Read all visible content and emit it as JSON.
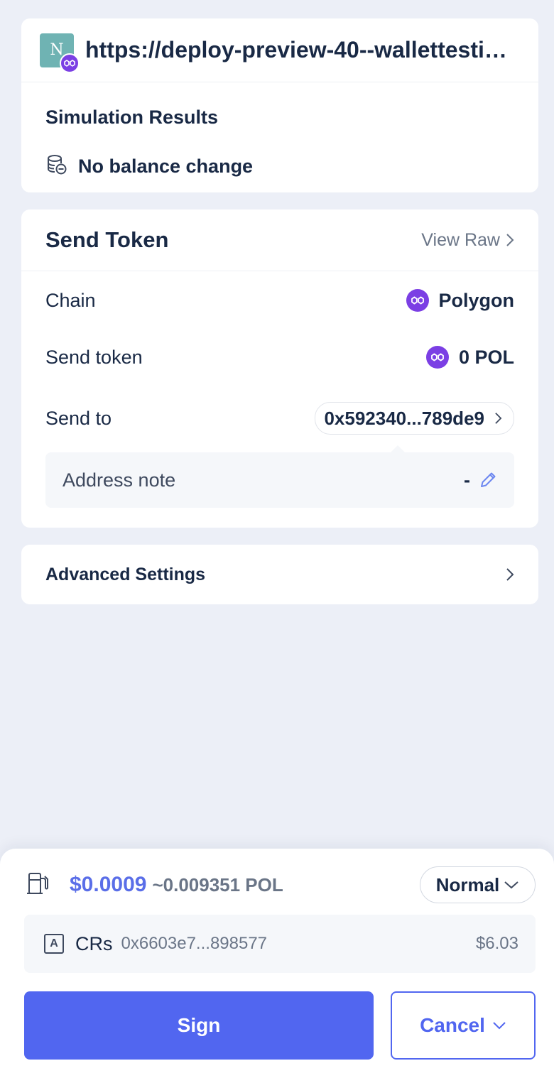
{
  "site": {
    "logo_letter": "N",
    "url": "https://deploy-preview-40--wallettesting.netlify.app",
    "chain_badge_icon": "polygon-icon"
  },
  "simulation": {
    "title": "Simulation Results",
    "result_text": "No balance change",
    "icon": "coins-minus-icon"
  },
  "send": {
    "title": "Send Token",
    "view_raw": "View Raw",
    "rows": {
      "chain_label": "Chain",
      "chain_value": "Polygon",
      "token_label": "Send token",
      "token_value": "0 POL",
      "to_label": "Send to",
      "to_value": "0x592340...789de9"
    },
    "note_label": "Address note",
    "note_value": "-"
  },
  "advanced": {
    "label": "Advanced Settings"
  },
  "footer": {
    "gas_usd": "$0.0009",
    "gas_native": "~0.009351 POL",
    "gas_speed": "Normal",
    "account_badge": "A",
    "account_name": "CRs",
    "account_address": "0x6603e7...898577",
    "account_balance": "$6.03",
    "sign_label": "Sign",
    "cancel_label": "Cancel"
  },
  "colors": {
    "primary": "#5166f0",
    "polygon": "#7b3fe4",
    "background": "#eceff7"
  }
}
